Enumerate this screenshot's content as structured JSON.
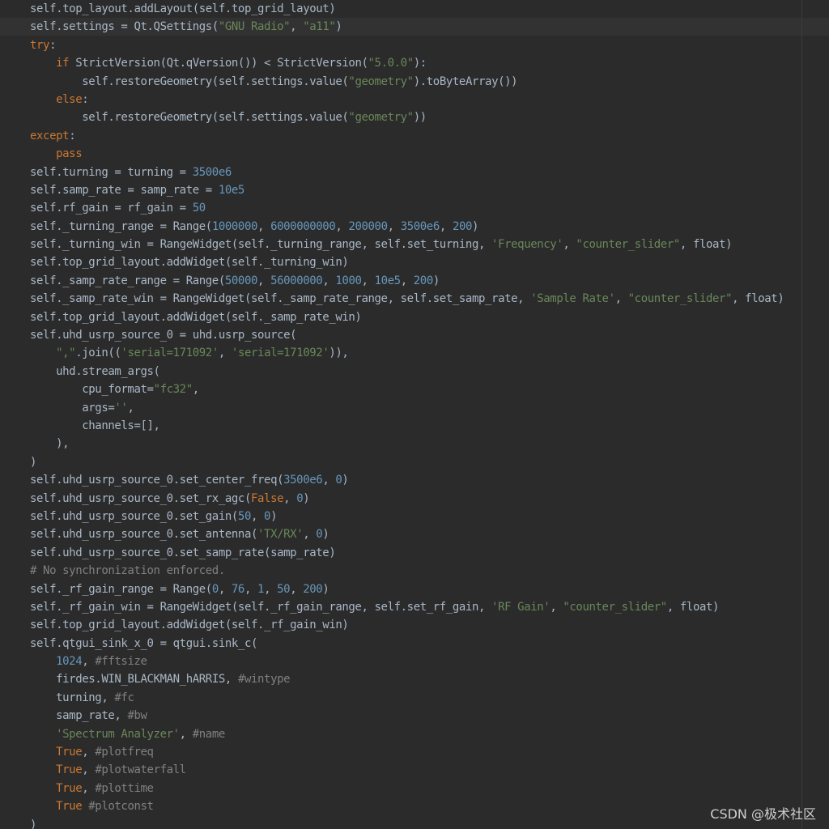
{
  "editor": {
    "watermark": "CSDN @极术社区",
    "colors": {
      "background": "#2b2b2b",
      "current_line": "#323232",
      "default": "#a9b7c6",
      "keyword": "#cc7832",
      "number": "#6897bb",
      "string": "#6a8759",
      "comment": "#808080"
    },
    "lines": [
      {
        "indent": "",
        "tokens": [
          {
            "t": "default",
            "v": "self.top_layout.addLayout(self.top_grid_layout)"
          }
        ]
      },
      {
        "indent": "",
        "tokens": [
          {
            "t": "default",
            "v": "self.settings = Qt.QSettings("
          },
          {
            "t": "string",
            "v": "\"GNU Radio\""
          },
          {
            "t": "default",
            "v": ", "
          },
          {
            "t": "string",
            "v": "\"a11\""
          },
          {
            "t": "default",
            "v": ")"
          }
        ]
      },
      {
        "indent": "",
        "tokens": [
          {
            "t": "keyword",
            "v": "try"
          },
          {
            "t": "default",
            "v": ":"
          }
        ]
      },
      {
        "indent": "    ",
        "tokens": [
          {
            "t": "keyword",
            "v": "if"
          },
          {
            "t": "default",
            "v": " StrictVersion(Qt.qVersion()) < StrictVersion("
          },
          {
            "t": "string",
            "v": "\"5.0.0\""
          },
          {
            "t": "default",
            "v": "):"
          }
        ]
      },
      {
        "indent": "        ",
        "tokens": [
          {
            "t": "default",
            "v": "self.restoreGeometry(self.settings.value("
          },
          {
            "t": "string",
            "v": "\"geometry\""
          },
          {
            "t": "default",
            "v": ").toByteArray())"
          }
        ]
      },
      {
        "indent": "    ",
        "tokens": [
          {
            "t": "keyword",
            "v": "else"
          },
          {
            "t": "default",
            "v": ":"
          }
        ]
      },
      {
        "indent": "        ",
        "tokens": [
          {
            "t": "default",
            "v": "self.restoreGeometry(self.settings.value("
          },
          {
            "t": "string",
            "v": "\"geometry\""
          },
          {
            "t": "default",
            "v": "))"
          }
        ]
      },
      {
        "indent": "",
        "tokens": [
          {
            "t": "keyword",
            "v": "except"
          },
          {
            "t": "default",
            "v": ":"
          }
        ]
      },
      {
        "indent": "    ",
        "tokens": [
          {
            "t": "keyword",
            "v": "pass"
          }
        ]
      },
      {
        "indent": "",
        "tokens": [
          {
            "t": "default",
            "v": "self.turning = turning = "
          },
          {
            "t": "number",
            "v": "3500e6"
          }
        ]
      },
      {
        "indent": "",
        "tokens": [
          {
            "t": "default",
            "v": "self.samp_rate = samp_rate = "
          },
          {
            "t": "number",
            "v": "10e5"
          }
        ]
      },
      {
        "indent": "",
        "tokens": [
          {
            "t": "default",
            "v": "self.rf_gain = rf_gain = "
          },
          {
            "t": "number",
            "v": "50"
          }
        ]
      },
      {
        "indent": "",
        "tokens": [
          {
            "t": "default",
            "v": "self._turning_range = Range("
          },
          {
            "t": "number",
            "v": "1000000"
          },
          {
            "t": "default",
            "v": ", "
          },
          {
            "t": "number",
            "v": "6000000000"
          },
          {
            "t": "default",
            "v": ", "
          },
          {
            "t": "number",
            "v": "200000"
          },
          {
            "t": "default",
            "v": ", "
          },
          {
            "t": "number",
            "v": "3500e6"
          },
          {
            "t": "default",
            "v": ", "
          },
          {
            "t": "number",
            "v": "200"
          },
          {
            "t": "default",
            "v": ")"
          }
        ]
      },
      {
        "indent": "",
        "tokens": [
          {
            "t": "default",
            "v": "self._turning_win = RangeWidget(self._turning_range, self.set_turning, "
          },
          {
            "t": "string",
            "v": "'Frequency'"
          },
          {
            "t": "default",
            "v": ", "
          },
          {
            "t": "string",
            "v": "\"counter_slider\""
          },
          {
            "t": "default",
            "v": ", float)"
          }
        ]
      },
      {
        "indent": "",
        "tokens": [
          {
            "t": "default",
            "v": "self.top_grid_layout.addWidget(self._turning_win)"
          }
        ]
      },
      {
        "indent": "",
        "tokens": [
          {
            "t": "default",
            "v": "self._samp_rate_range = Range("
          },
          {
            "t": "number",
            "v": "50000"
          },
          {
            "t": "default",
            "v": ", "
          },
          {
            "t": "number",
            "v": "56000000"
          },
          {
            "t": "default",
            "v": ", "
          },
          {
            "t": "number",
            "v": "1000"
          },
          {
            "t": "default",
            "v": ", "
          },
          {
            "t": "number",
            "v": "10e5"
          },
          {
            "t": "default",
            "v": ", "
          },
          {
            "t": "number",
            "v": "200"
          },
          {
            "t": "default",
            "v": ")"
          }
        ]
      },
      {
        "indent": "",
        "tokens": [
          {
            "t": "default",
            "v": "self._samp_rate_win = RangeWidget(self._samp_rate_range, self.set_samp_rate, "
          },
          {
            "t": "string",
            "v": "'Sample Rate'"
          },
          {
            "t": "default",
            "v": ", "
          },
          {
            "t": "string",
            "v": "\"counter_slider\""
          },
          {
            "t": "default",
            "v": ", float)"
          }
        ]
      },
      {
        "indent": "",
        "tokens": [
          {
            "t": "default",
            "v": "self.top_grid_layout.addWidget(self._samp_rate_win)"
          }
        ]
      },
      {
        "indent": "",
        "tokens": [
          {
            "t": "default",
            "v": "self.uhd_usrp_source_0 = uhd.usrp_source("
          }
        ]
      },
      {
        "indent": "    ",
        "tokens": [
          {
            "t": "string",
            "v": "\",\""
          },
          {
            "t": "default",
            "v": ".join(("
          },
          {
            "t": "string",
            "v": "'serial=171092'"
          },
          {
            "t": "default",
            "v": ", "
          },
          {
            "t": "string",
            "v": "'serial=171092'"
          },
          {
            "t": "default",
            "v": ")),"
          }
        ]
      },
      {
        "indent": "    ",
        "tokens": [
          {
            "t": "default",
            "v": "uhd.stream_args("
          }
        ]
      },
      {
        "indent": "        ",
        "tokens": [
          {
            "t": "default",
            "v": "cpu_format="
          },
          {
            "t": "string",
            "v": "\"fc32\""
          },
          {
            "t": "default",
            "v": ","
          }
        ]
      },
      {
        "indent": "        ",
        "tokens": [
          {
            "t": "default",
            "v": "args="
          },
          {
            "t": "string",
            "v": "''"
          },
          {
            "t": "default",
            "v": ","
          }
        ]
      },
      {
        "indent": "        ",
        "tokens": [
          {
            "t": "default",
            "v": "channels=[],"
          }
        ]
      },
      {
        "indent": "    ",
        "tokens": [
          {
            "t": "default",
            "v": "),"
          }
        ]
      },
      {
        "indent": "",
        "tokens": [
          {
            "t": "default",
            "v": ")"
          }
        ]
      },
      {
        "indent": "",
        "tokens": [
          {
            "t": "default",
            "v": "self.uhd_usrp_source_0.set_center_freq("
          },
          {
            "t": "number",
            "v": "3500e6"
          },
          {
            "t": "default",
            "v": ", "
          },
          {
            "t": "number",
            "v": "0"
          },
          {
            "t": "default",
            "v": ")"
          }
        ]
      },
      {
        "indent": "",
        "tokens": [
          {
            "t": "default",
            "v": "self.uhd_usrp_source_0.set_rx_agc("
          },
          {
            "t": "keyword",
            "v": "False"
          },
          {
            "t": "default",
            "v": ", "
          },
          {
            "t": "number",
            "v": "0"
          },
          {
            "t": "default",
            "v": ")"
          }
        ]
      },
      {
        "indent": "",
        "tokens": [
          {
            "t": "default",
            "v": "self.uhd_usrp_source_0.set_gain("
          },
          {
            "t": "number",
            "v": "50"
          },
          {
            "t": "default",
            "v": ", "
          },
          {
            "t": "number",
            "v": "0"
          },
          {
            "t": "default",
            "v": ")"
          }
        ]
      },
      {
        "indent": "",
        "tokens": [
          {
            "t": "default",
            "v": "self.uhd_usrp_source_0.set_antenna("
          },
          {
            "t": "string",
            "v": "'TX/RX'"
          },
          {
            "t": "default",
            "v": ", "
          },
          {
            "t": "number",
            "v": "0"
          },
          {
            "t": "default",
            "v": ")"
          }
        ]
      },
      {
        "indent": "",
        "tokens": [
          {
            "t": "default",
            "v": "self.uhd_usrp_source_0.set_samp_rate(samp_rate)"
          }
        ]
      },
      {
        "indent": "",
        "tokens": [
          {
            "t": "comment",
            "v": "# No synchronization enforced."
          }
        ]
      },
      {
        "indent": "",
        "tokens": [
          {
            "t": "default",
            "v": "self._rf_gain_range = Range("
          },
          {
            "t": "number",
            "v": "0"
          },
          {
            "t": "default",
            "v": ", "
          },
          {
            "t": "number",
            "v": "76"
          },
          {
            "t": "default",
            "v": ", "
          },
          {
            "t": "number",
            "v": "1"
          },
          {
            "t": "default",
            "v": ", "
          },
          {
            "t": "number",
            "v": "50"
          },
          {
            "t": "default",
            "v": ", "
          },
          {
            "t": "number",
            "v": "200"
          },
          {
            "t": "default",
            "v": ")"
          }
        ]
      },
      {
        "indent": "",
        "tokens": [
          {
            "t": "default",
            "v": "self._rf_gain_win = RangeWidget(self._rf_gain_range, self.set_rf_gain, "
          },
          {
            "t": "string",
            "v": "'RF Gain'"
          },
          {
            "t": "default",
            "v": ", "
          },
          {
            "t": "string",
            "v": "\"counter_slider\""
          },
          {
            "t": "default",
            "v": ", float)"
          }
        ]
      },
      {
        "indent": "",
        "tokens": [
          {
            "t": "default",
            "v": "self.top_grid_layout.addWidget(self._rf_gain_win)"
          }
        ]
      },
      {
        "indent": "",
        "tokens": [
          {
            "t": "default",
            "v": "self.qtgui_sink_x_0 = qtgui.sink_c("
          }
        ]
      },
      {
        "indent": "    ",
        "tokens": [
          {
            "t": "number",
            "v": "1024"
          },
          {
            "t": "default",
            "v": ", "
          },
          {
            "t": "comment",
            "v": "#fftsize"
          }
        ]
      },
      {
        "indent": "    ",
        "tokens": [
          {
            "t": "default",
            "v": "firdes.WIN_BLACKMAN_hARRIS, "
          },
          {
            "t": "comment",
            "v": "#wintype"
          }
        ]
      },
      {
        "indent": "    ",
        "tokens": [
          {
            "t": "default",
            "v": "turning, "
          },
          {
            "t": "comment",
            "v": "#fc"
          }
        ]
      },
      {
        "indent": "    ",
        "tokens": [
          {
            "t": "default",
            "v": "samp_rate, "
          },
          {
            "t": "comment",
            "v": "#bw"
          }
        ]
      },
      {
        "indent": "    ",
        "tokens": [
          {
            "t": "string",
            "v": "'Spectrum Analyzer'"
          },
          {
            "t": "default",
            "v": ", "
          },
          {
            "t": "comment",
            "v": "#name"
          }
        ]
      },
      {
        "indent": "    ",
        "tokens": [
          {
            "t": "keyword",
            "v": "True"
          },
          {
            "t": "default",
            "v": ", "
          },
          {
            "t": "comment",
            "v": "#plotfreq"
          }
        ]
      },
      {
        "indent": "    ",
        "tokens": [
          {
            "t": "keyword",
            "v": "True"
          },
          {
            "t": "default",
            "v": ", "
          },
          {
            "t": "comment",
            "v": "#plotwaterfall"
          }
        ]
      },
      {
        "indent": "    ",
        "tokens": [
          {
            "t": "keyword",
            "v": "True"
          },
          {
            "t": "default",
            "v": ", "
          },
          {
            "t": "comment",
            "v": "#plottime"
          }
        ]
      },
      {
        "indent": "    ",
        "tokens": [
          {
            "t": "keyword",
            "v": "True"
          },
          {
            "t": "default",
            "v": " "
          },
          {
            "t": "comment",
            "v": "#plotconst"
          }
        ]
      },
      {
        "indent": "",
        "tokens": [
          {
            "t": "default",
            "v": ")"
          }
        ]
      }
    ]
  }
}
